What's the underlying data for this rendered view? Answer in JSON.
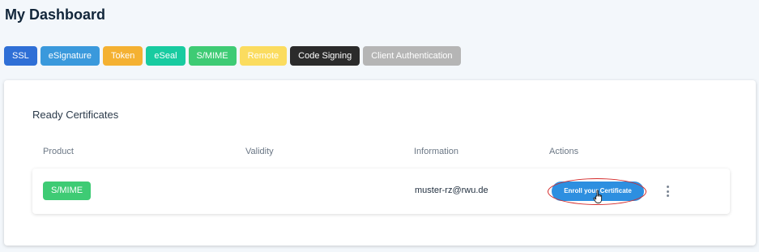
{
  "page": {
    "title": "My Dashboard"
  },
  "tags": [
    {
      "label": "SSL",
      "color": "#2f6fd6"
    },
    {
      "label": "eSignature",
      "color": "#3a99dc"
    },
    {
      "label": "Token",
      "color": "#f4b132"
    },
    {
      "label": "eSeal",
      "color": "#18cba0"
    },
    {
      "label": "S/MIME",
      "color": "#3ecb74"
    },
    {
      "label": "Remote",
      "color": "#fbdc5f"
    },
    {
      "label": "Code Signing",
      "color": "#2b2b2b"
    },
    {
      "label": "Client Authentication",
      "color": "#b5b5b5"
    }
  ],
  "card": {
    "title": "Ready Certificates",
    "columns": {
      "product": "Product",
      "validity": "Validity",
      "information": "Information",
      "actions": "Actions"
    },
    "rows": [
      {
        "product": "S/MIME",
        "product_color": "#3ecb74",
        "validity": "",
        "information": "muster-rz@rwu.de",
        "action_label": "Enroll your Certificate",
        "action_color": "#2d8fe0"
      }
    ]
  },
  "icons": {
    "more": "more-vertical-icon",
    "cursor": "pointer-hand-icon"
  }
}
